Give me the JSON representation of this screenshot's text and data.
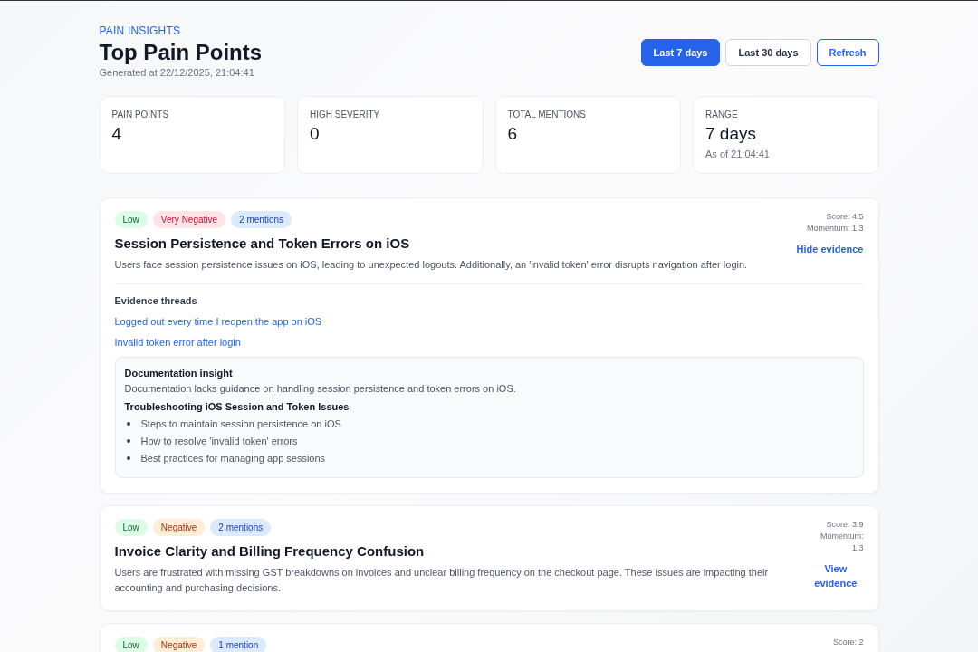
{
  "header": {
    "eyebrow": "PAIN INSIGHTS",
    "title": "Top Pain Points",
    "generated": "Generated at 22/12/2025, 21:04:41"
  },
  "range_buttons": [
    {
      "label": "Last 7 days",
      "selected": true
    },
    {
      "label": "Last 30 days",
      "selected": false
    }
  ],
  "refresh_button": "Refresh",
  "stats": [
    {
      "label": "PAIN POINTS",
      "value": "4"
    },
    {
      "label": "HIGH SEVERITY",
      "value": "0"
    },
    {
      "label": "TOTAL MENTIONS",
      "value": "6"
    },
    {
      "label": "RANGE",
      "value": "7 days",
      "note": "As of 21:04:41"
    }
  ],
  "pain_points": [
    {
      "tags": [
        {
          "kind": "severity-low",
          "text": "Low"
        },
        {
          "kind": "very-negative",
          "text": "Very Negative"
        },
        {
          "kind": "mentions",
          "text": "2 mentions"
        }
      ],
      "title": "Session Persistence and Token Errors on iOS",
      "description": "Users face session persistence issues on iOS, leading to unexpected logouts. Additionally, an 'invalid token' error disrupts navigation after login.",
      "score": "Score: 4.5",
      "momentum": "Momentum: 1.3",
      "toggle": "Hide evidence",
      "evidence": {
        "heading": "Evidence threads",
        "threads": [
          "Logged out every time I reopen the app on iOS",
          "Invalid token error after login"
        ],
        "insight": {
          "heading": "Documentation insight",
          "text": "Documentation lacks guidance on handling session persistence and token errors on iOS.",
          "doc_title": "Troubleshooting iOS Session and Token Issues",
          "points": [
            "Steps to maintain session persistence on iOS",
            "How to resolve 'invalid token' errors",
            "Best practices for managing app sessions"
          ]
        }
      }
    },
    {
      "tags": [
        {
          "kind": "severity-low",
          "text": "Low"
        },
        {
          "kind": "negative",
          "text": "Negative"
        },
        {
          "kind": "mentions",
          "text": "2 mentions"
        }
      ],
      "title": "Invoice Clarity and Billing Frequency Confusion",
      "description": "Users are frustrated with missing GST breakdowns on invoices and unclear billing frequency on the checkout page. These issues are impacting their accounting and purchasing decisions.",
      "score": "Score: 3.9",
      "momentum": "Momentum: 1.3",
      "toggle": "View evidence"
    },
    {
      "tags": [
        {
          "kind": "severity-low",
          "text": "Low"
        },
        {
          "kind": "negative",
          "text": "Negative"
        },
        {
          "kind": "mentions",
          "text": "1 mention"
        }
      ],
      "score": "Score: 2"
    }
  ]
}
